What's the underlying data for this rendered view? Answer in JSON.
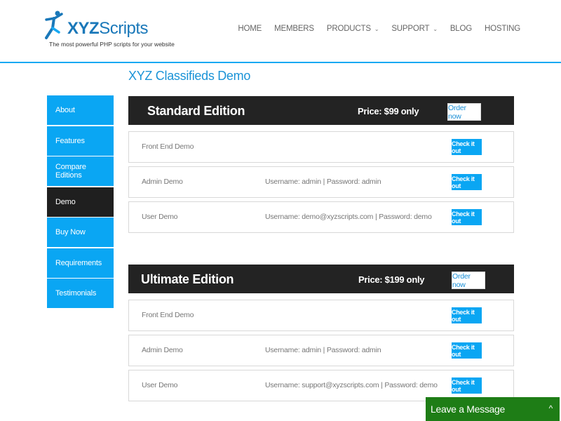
{
  "header": {
    "brand_prefix": "XYZ",
    "brand_suffix": "Scripts",
    "tagline": "The most powerful PHP scripts for your website",
    "nav": [
      {
        "label": "HOME",
        "has_dropdown": false
      },
      {
        "label": "MEMBERS",
        "has_dropdown": false
      },
      {
        "label": "PRODUCTS",
        "has_dropdown": true
      },
      {
        "label": "SUPPORT",
        "has_dropdown": true
      },
      {
        "label": "BLOG",
        "has_dropdown": false
      },
      {
        "label": "HOSTING",
        "has_dropdown": false
      }
    ],
    "chevron_glyph": "⌄"
  },
  "page_title": "XYZ Classifieds Demo",
  "sidebar": {
    "items": [
      {
        "label": "About",
        "active": false
      },
      {
        "label": "Features",
        "active": false
      },
      {
        "label": "Compare Editions",
        "active": false
      },
      {
        "label": "Demo",
        "active": true
      },
      {
        "label": "Buy Now",
        "active": false
      },
      {
        "label": "Requirements",
        "active": false
      },
      {
        "label": "Testimonials",
        "active": false
      }
    ]
  },
  "editions": [
    {
      "name": "Standard Edition",
      "price": "Price: $99 only",
      "order_label": "Order now",
      "rows": [
        {
          "label": "Front End Demo",
          "creds": "",
          "button": "Check it out"
        },
        {
          "label": "Admin Demo",
          "creds": "Username: admin | Password: admin",
          "button": "Check it out"
        },
        {
          "label": "User Demo",
          "creds": "Username: demo@xyzscripts.com | Password: demo",
          "button": "Check it out"
        }
      ]
    },
    {
      "name": "Ultimate Edition",
      "price": "Price: $199 only",
      "order_label": "Order now",
      "rows": [
        {
          "label": "Front End Demo",
          "creds": "",
          "button": "Check it out"
        },
        {
          "label": "Admin Demo",
          "creds": "Username: admin | Password: admin",
          "button": "Check it out"
        },
        {
          "label": "User Demo",
          "creds": "Username: support@xyzscripts.com | Password: demo",
          "button": "Check it out"
        }
      ]
    }
  ],
  "chat": {
    "label": "Leave a Message",
    "caret": "^"
  },
  "colors": {
    "accent_blue": "#0aa6f3",
    "brand_blue": "#1a78b9",
    "dark": "#232323",
    "chat_green": "#1e7d16"
  },
  "icons": {
    "logo": "running-person-logo-icon"
  }
}
